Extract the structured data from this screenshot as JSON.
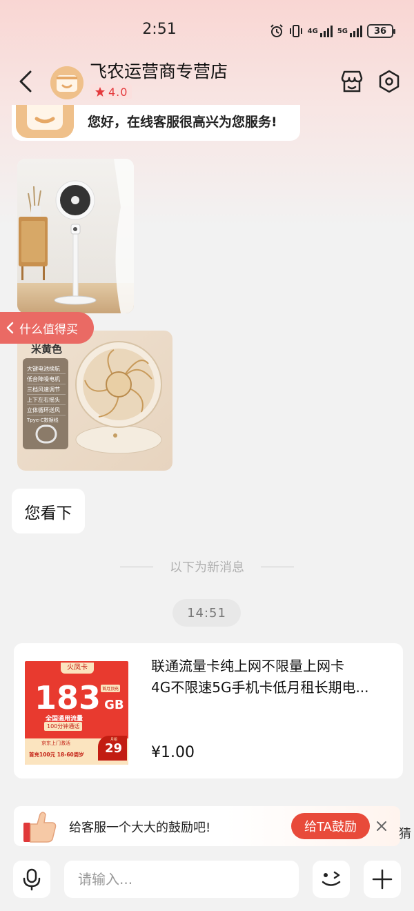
{
  "status_bar": {
    "time": "2:51",
    "network_1": "4G",
    "network_2": "5G",
    "battery": "36"
  },
  "header": {
    "shop_name": "飞农运营商专营店",
    "rating": "4.0"
  },
  "messages": {
    "welcome": "您好，在线客服很高兴为您服务!",
    "image2_caption": "米黄色",
    "image2_features": [
      "大键电池续航",
      "低音降噪电机",
      "三档风速调节",
      "上下左右摇头",
      "立体循环送风",
      "Tpye-C数据线"
    ],
    "reply_text": "您看下"
  },
  "side_tag": {
    "label": "什么值得买"
  },
  "divider": {
    "label": "以下为新消息"
  },
  "timestamp": "14:51",
  "product": {
    "title_line1": "联通流量卡纯上网不限量上网卡",
    "title_line2": "4G不限速5G手机卡低月租长期电...",
    "price": "¥1.00",
    "image_text": {
      "brand": "火凤卡",
      "data": "183",
      "unit": "GB",
      "tag": "首月顶充",
      "desc": "全国通用流量",
      "minutes": "100分钟通话",
      "footer1": "京东上门激活",
      "footer2": "首充100元  18-60周岁",
      "monthly": "月租",
      "monthly_price": "29"
    }
  },
  "encourage": {
    "text": "给客服一个大大的鼓励吧!",
    "button": "给TA鼓励",
    "peek": "猜"
  },
  "input": {
    "placeholder": "请输入..."
  },
  "colors": {
    "accent": "#e84a3a",
    "star": "#e4393c",
    "side_tag": "#ea6a64"
  }
}
